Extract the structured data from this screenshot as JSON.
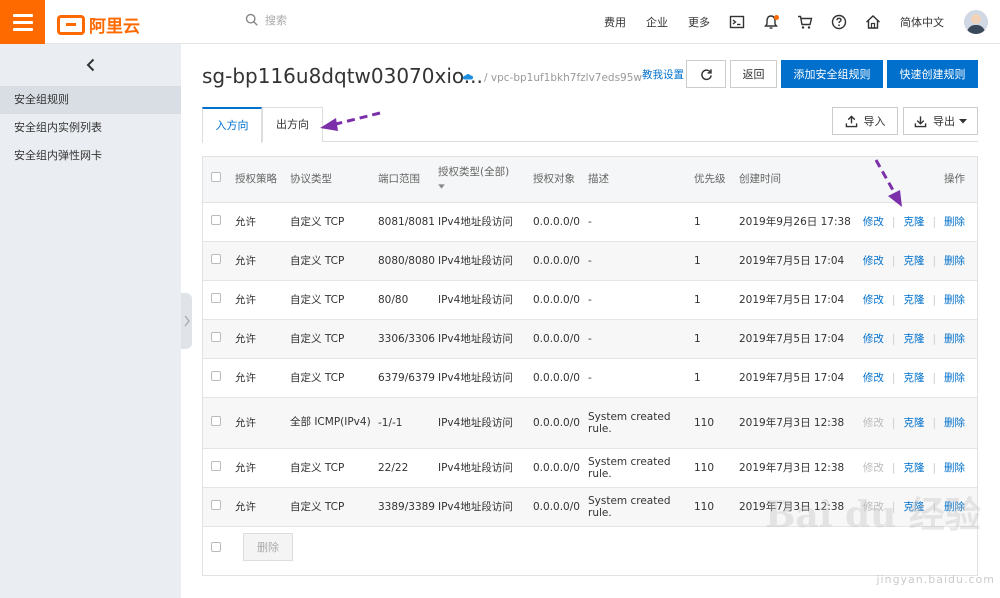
{
  "topbar": {
    "logo_text": "阿里云",
    "search_placeholder": "搜索",
    "nav": [
      "费用",
      "企业",
      "更多"
    ],
    "language": "简体中文"
  },
  "sidebar": {
    "items": [
      {
        "label": "安全组规则",
        "active": true
      },
      {
        "label": "安全组内实例列表",
        "active": false
      },
      {
        "label": "安全组内弹性网卡",
        "active": false
      }
    ]
  },
  "header": {
    "title": "sg-bp116u8dqtw03070xio...",
    "vpc": "/ vpc-bp1uf1bkh7fzlv7eds95w",
    "teach_label": "教我设置",
    "back_label": "返回",
    "add_rule_label": "添加安全组规则",
    "quick_rule_label": "快速创建规则"
  },
  "tabs": [
    {
      "label": "入方向",
      "active": true
    },
    {
      "label": "出方向",
      "active": false
    }
  ],
  "toolbar": {
    "import_label": "导入",
    "export_label": "导出"
  },
  "table": {
    "headers": {
      "policy": "授权策略",
      "protocol": "协议类型",
      "port": "端口范围",
      "auth_type": "授权类型(全部)",
      "auth_obj": "授权对象",
      "desc": "描述",
      "priority": "优先级",
      "created": "创建时间",
      "ops": "操作"
    },
    "rows": [
      {
        "policy": "允许",
        "protocol": "自定义 TCP",
        "port": "8081/8081",
        "auth_type": "IPv4地址段访问",
        "auth_obj": "0.0.0.0/0",
        "desc": "-",
        "priority": "1",
        "created": "2019年9月26日 17:38",
        "edit": "修改",
        "clone": "克隆",
        "delete": "删除",
        "edit_enabled": true
      },
      {
        "policy": "允许",
        "protocol": "自定义 TCP",
        "port": "8080/8080",
        "auth_type": "IPv4地址段访问",
        "auth_obj": "0.0.0.0/0",
        "desc": "-",
        "priority": "1",
        "created": "2019年7月5日 17:04",
        "edit": "修改",
        "clone": "克隆",
        "delete": "删除",
        "edit_enabled": true
      },
      {
        "policy": "允许",
        "protocol": "自定义 TCP",
        "port": "80/80",
        "auth_type": "IPv4地址段访问",
        "auth_obj": "0.0.0.0/0",
        "desc": "-",
        "priority": "1",
        "created": "2019年7月5日 17:04",
        "edit": "修改",
        "clone": "克隆",
        "delete": "删除",
        "edit_enabled": true
      },
      {
        "policy": "允许",
        "protocol": "自定义 TCP",
        "port": "3306/3306",
        "auth_type": "IPv4地址段访问",
        "auth_obj": "0.0.0.0/0",
        "desc": "-",
        "priority": "1",
        "created": "2019年7月5日 17:04",
        "edit": "修改",
        "clone": "克隆",
        "delete": "删除",
        "edit_enabled": true
      },
      {
        "policy": "允许",
        "protocol": "自定义 TCP",
        "port": "6379/6379",
        "auth_type": "IPv4地址段访问",
        "auth_obj": "0.0.0.0/0",
        "desc": "-",
        "priority": "1",
        "created": "2019年7月5日 17:04",
        "edit": "修改",
        "clone": "克隆",
        "delete": "删除",
        "edit_enabled": true
      },
      {
        "policy": "允许",
        "protocol": "全部 ICMP(IPv4)",
        "port": "-1/-1",
        "auth_type": "IPv4地址段访问",
        "auth_obj": "0.0.0.0/0",
        "desc": "System created rule.",
        "priority": "110",
        "created": "2019年7月3日 12:38",
        "edit": "修改",
        "clone": "克隆",
        "delete": "删除",
        "edit_enabled": false
      },
      {
        "policy": "允许",
        "protocol": "自定义 TCP",
        "port": "22/22",
        "auth_type": "IPv4地址段访问",
        "auth_obj": "0.0.0.0/0",
        "desc": "System created rule.",
        "priority": "110",
        "created": "2019年7月3日 12:38",
        "edit": "修改",
        "clone": "克隆",
        "delete": "删除",
        "edit_enabled": false
      },
      {
        "policy": "允许",
        "protocol": "自定义 TCP",
        "port": "3389/3389",
        "auth_type": "IPv4地址段访问",
        "auth_obj": "0.0.0.0/0",
        "desc": "System created rule.",
        "priority": "110",
        "created": "2019年7月3日 12:38",
        "edit": "修改",
        "clone": "克隆",
        "delete": "删除",
        "edit_enabled": false
      }
    ],
    "delete_button": "删除"
  },
  "watermark": {
    "logo": "Bai du 经验",
    "url": "jingyan.baidu.com"
  },
  "colors": {
    "brand": "#ff6a00",
    "primary": "#0070cc",
    "annotation": "#7b2fa8"
  }
}
